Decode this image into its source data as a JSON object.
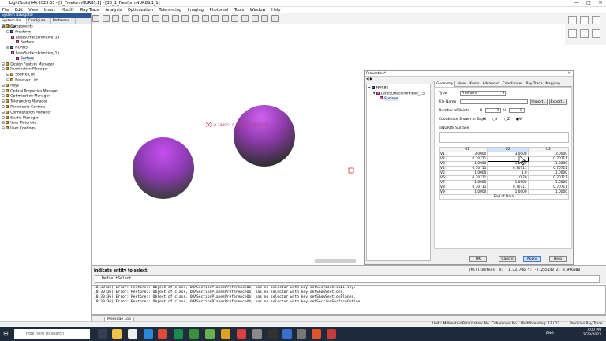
{
  "window": {
    "title": "LightTools(64) 2023.03 - [1_FreeformNURBS.1] - [3D_1_FreeformNURBS.1_1]",
    "min": "—",
    "max": "□",
    "close": "✕"
  },
  "menu": [
    "File",
    "Edit",
    "View",
    "Insert",
    "Modify",
    "Ray Trace",
    "Analysis",
    "Optimization",
    "Tolerancing",
    "Imaging",
    "Photoreal",
    "Tools",
    "Window",
    "Help"
  ],
  "nav": {
    "title": "System Navigator",
    "tabs": [
      "System Na...",
      "Configura...",
      "Preferenc...",
      "Window..."
    ],
    "tree": [
      {
        "label": "Components",
        "level": 0,
        "icon": "folder-icon"
      },
      {
        "label": "Freeform",
        "level": 1,
        "icon": "solid-icon"
      },
      {
        "label": "LensSurfacePrimitive_14",
        "level": 2,
        "icon": "surface-icon"
      },
      {
        "label": "Surface",
        "level": 3,
        "icon": "surface-icon"
      },
      {
        "label": "NURBS",
        "level": 1,
        "icon": "solid-icon"
      },
      {
        "label": "LensSurfacePrimitive_15",
        "level": 2,
        "icon": "surface-icon"
      },
      {
        "label": "Surface",
        "level": 3,
        "icon": "surface-icon",
        "selected": true
      },
      {
        "label": "Design Feature Manager",
        "level": 0,
        "icon": "folder-icon"
      },
      {
        "label": "Illumination Manager",
        "level": 0,
        "icon": "folder-icon"
      },
      {
        "label": "Source List",
        "level": 1,
        "icon": "folder-icon"
      },
      {
        "label": "Receiver List",
        "level": 1,
        "icon": "folder-icon"
      },
      {
        "label": "Rays",
        "level": 0,
        "icon": "folder-icon"
      },
      {
        "label": "Optical Properties Manager",
        "level": 0,
        "icon": "folder-icon"
      },
      {
        "label": "Optimization Manager",
        "level": 0,
        "icon": "folder-icon"
      },
      {
        "label": "Tolerancing Manager",
        "level": 0,
        "icon": "folder-icon"
      },
      {
        "label": "Parametric Controls",
        "level": 0,
        "icon": "folder-icon"
      },
      {
        "label": "Configuration Manager",
        "level": 0,
        "icon": "folder-icon"
      },
      {
        "label": "Studio Manager",
        "level": 0,
        "icon": "folder-icon"
      },
      {
        "label": "User Materials",
        "level": 0,
        "icon": "folder-icon"
      },
      {
        "label": "User Coatings",
        "level": 0,
        "icon": "folder-icon"
      }
    ]
  },
  "viewport": {
    "coord": "[-0.289951 0.000000 0.057677]"
  },
  "props": {
    "title": "Properties*",
    "tree": [
      {
        "label": "NURBS",
        "level": 0
      },
      {
        "label": "LensSurfacePrimitive_15",
        "level": 1
      },
      {
        "label": "Surface",
        "level": 2
      }
    ],
    "tabs": [
      "Geometry",
      "Holes",
      "Knots",
      "Advanced",
      "Coordinates",
      "Ray Trace",
      "Mapping"
    ],
    "type_label": "Type",
    "type_value": "Freeform",
    "filename_label": "File Name",
    "import": "Import...",
    "export": "Export...",
    "npoints_label": "Number of Points",
    "u_label": "U",
    "u_value": "3",
    "v_label": "V",
    "v_value": "9",
    "coord_label": "Coordinate Shown in Table",
    "coord_opts": [
      "X",
      "Y",
      "Z",
      "W"
    ],
    "nurbs_label": "NURBS Surface",
    "cols": [
      "U1",
      "U2",
      "U3"
    ],
    "rows": [
      {
        "h": "V1",
        "c": [
          "3.0000",
          "3.0000",
          "3.0000"
        ]
      },
      {
        "h": "V2",
        "c": [
          "0.70711",
          "",
          "0.70711"
        ]
      },
      {
        "h": "V3",
        "c": [
          "1.0000",
          "1.0000",
          "1.0000"
        ]
      },
      {
        "h": "V4",
        "c": [
          "0.70711",
          "0.70711",
          "0.70711"
        ]
      },
      {
        "h": "V5",
        "c": [
          "1.0000",
          "1.0",
          "1.0000"
        ]
      },
      {
        "h": "V6",
        "c": [
          "0.70711",
          "0.70",
          "0.70711"
        ]
      },
      {
        "h": "V7",
        "c": [
          "1.0000",
          "1.0000",
          "1.0000"
        ]
      },
      {
        "h": "V8",
        "c": [
          "0.70711",
          "0.70711",
          "0.70711"
        ]
      },
      {
        "h": "V9",
        "c": [
          "1.0000",
          "1.0000",
          "1.0000"
        ]
      }
    ],
    "end": "End of Data",
    "ok": "OK",
    "cancel": "Cancel",
    "apply": "Apply",
    "help": "Help"
  },
  "cmd": {
    "prompt": "Indicate entity to select.",
    "units": "(Millimeters)",
    "x": "X: -1.331706",
    "y": "Y: -2.255148",
    "z": "Z: 3.996000",
    "input": "DefaultSelect"
  },
  "log": [
    "10:30:36) Error: Restore:: Object of class, ORASectionPlanesPreferenceObj has no selector with key setSectionVisibility.",
    "10:30:36) Error: Restore:: Object of class, ORASectionPlanesPreferenceObj has no selector with key setShowSections.",
    "10:30:36) Error: Restore:: Object of class, ORASectionPlanesPreferenceObj has no selector with key setShowSectionPlanes.",
    "10:30:36) Error: Restore:: Object of class, ORASectionPlanesPreferenceObj has no selector with key setSectionSurfaceOption."
  ],
  "logtab": "Message Log",
  "status": {
    "units": "Units: Millimeters",
    "pol": "Polarization: No",
    "coh": "Coherence: No",
    "mt": "Multithreading: 12 / 12",
    "pr": "Precision Ray Trace"
  },
  "taskbar": {
    "search": "Type here to search",
    "time": "7:00 PM",
    "date": "2/28/2023",
    "lang": "ENG"
  }
}
